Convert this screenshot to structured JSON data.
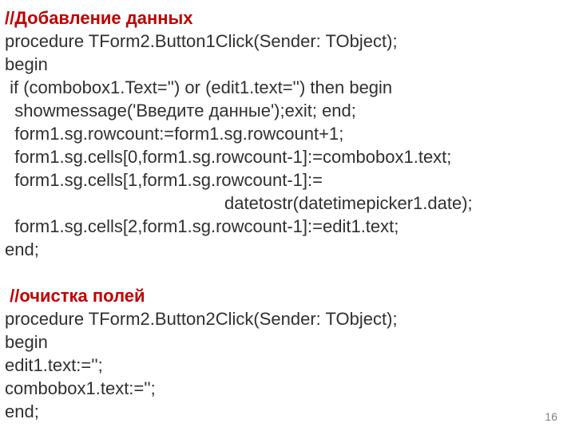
{
  "lines": [
    {
      "cls": "",
      "parts": [
        {
          "cls": "red",
          "text": "//Добавление данных"
        }
      ]
    },
    {
      "cls": "",
      "parts": [
        {
          "cls": "",
          "text": "procedure TForm2.Button1Click(Sender: TObject);"
        }
      ]
    },
    {
      "cls": "",
      "parts": [
        {
          "cls": "",
          "text": "begin"
        }
      ]
    },
    {
      "cls": "",
      "parts": [
        {
          "cls": "",
          "text": " if (combobox1.Text='') or (edit1.text='') then begin"
        }
      ]
    },
    {
      "cls": "",
      "parts": [
        {
          "cls": "",
          "text": "  showmessage('Введите данные');exit; end;"
        }
      ]
    },
    {
      "cls": "",
      "parts": [
        {
          "cls": "",
          "text": "  form1.sg.rowcount:=form1.sg.rowcount+1;"
        }
      ]
    },
    {
      "cls": "",
      "parts": [
        {
          "cls": "",
          "text": "  form1.sg.cells[0,form1.sg.rowcount-1]:=combobox1.text;"
        }
      ]
    },
    {
      "cls": "",
      "parts": [
        {
          "cls": "",
          "text": "  form1.sg.cells[1,form1.sg.rowcount-1]:="
        }
      ]
    },
    {
      "cls": "",
      "parts": [
        {
          "cls": "",
          "text": "                                             datetostr(datetimepicker1.date);"
        }
      ]
    },
    {
      "cls": "",
      "parts": [
        {
          "cls": "",
          "text": "  form1.sg.cells[2,form1.sg.rowcount-1]:=edit1.text;"
        }
      ]
    },
    {
      "cls": "",
      "parts": [
        {
          "cls": "",
          "text": "end;"
        }
      ]
    },
    {
      "cls": "",
      "parts": [
        {
          "cls": "",
          "text": " "
        }
      ]
    },
    {
      "cls": "",
      "parts": [
        {
          "cls": "red",
          "text": " //очистка полей"
        }
      ]
    },
    {
      "cls": "",
      "parts": [
        {
          "cls": "",
          "text": "procedure TForm2.Button2Click(Sender: TObject);"
        }
      ]
    },
    {
      "cls": "",
      "parts": [
        {
          "cls": "",
          "text": "begin"
        }
      ]
    },
    {
      "cls": "",
      "parts": [
        {
          "cls": "",
          "text": "edit1.text:='';"
        }
      ]
    },
    {
      "cls": "",
      "parts": [
        {
          "cls": "",
          "text": "combobox1.text:='';"
        }
      ]
    },
    {
      "cls": "",
      "parts": [
        {
          "cls": "",
          "text": "end;"
        }
      ]
    }
  ],
  "page_number": "16"
}
